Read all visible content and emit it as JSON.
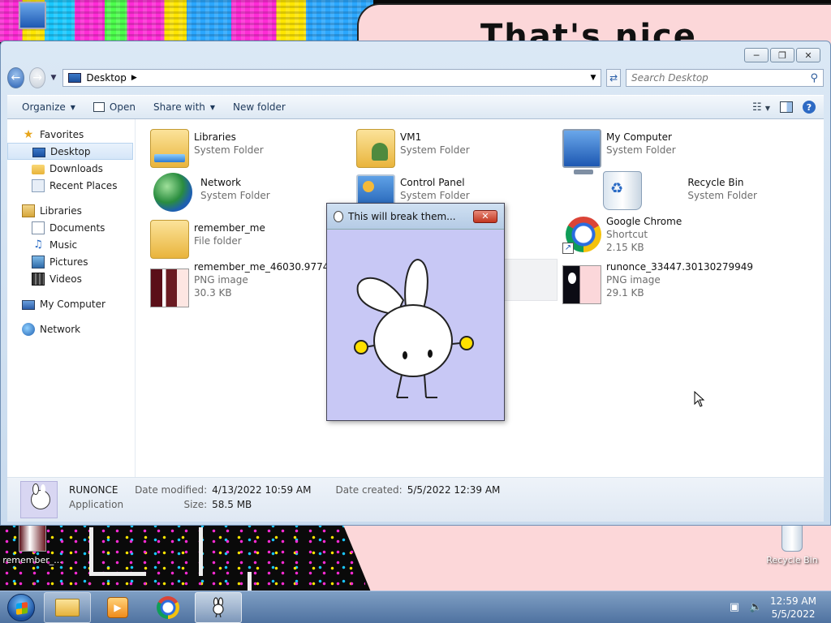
{
  "desktop": {
    "background_text": "That's nice",
    "icons": [
      {
        "label": ""
      },
      {
        "label": "remember_..."
      },
      {
        "label": "Recycle Bin"
      }
    ]
  },
  "explorer": {
    "address": {
      "location": "Desktop"
    },
    "search": {
      "placeholder": "Search Desktop"
    },
    "toolbar": {
      "organize": "Organize",
      "open": "Open",
      "share_with": "Share with",
      "new_folder": "New folder"
    },
    "nav_pane": {
      "favorites": "Favorites",
      "favorites_items": [
        "Desktop",
        "Downloads",
        "Recent Places"
      ],
      "libraries": "Libraries",
      "libraries_items": [
        "Documents",
        "Music",
        "Pictures",
        "Videos"
      ],
      "my_computer": "My Computer",
      "network": "Network"
    },
    "items": [
      {
        "name": "Libraries",
        "sub1": "System Folder",
        "sub2": ""
      },
      {
        "name": "VM1",
        "sub1": "System Folder",
        "sub2": ""
      },
      {
        "name": "My Computer",
        "sub1": "System Folder",
        "sub2": ""
      },
      {
        "name": "Network",
        "sub1": "System Folder",
        "sub2": ""
      },
      {
        "name": "Control Panel",
        "sub1": "System Folder",
        "sub2": ""
      },
      {
        "name": "Recycle Bin",
        "sub1": "System Folder",
        "sub2": ""
      },
      {
        "name": "remember_me",
        "sub1": "File folder",
        "sub2": ""
      },
      {
        "name": "Google Chrome",
        "sub1": "Shortcut",
        "sub2": "2.15 KB"
      },
      {
        "name": "remember_me_46030.97749985",
        "sub1": "PNG image",
        "sub2": "30.3 KB"
      },
      {
        "name": "runonce_33447.30130279949",
        "sub1": "PNG image",
        "sub2": "29.1 KB"
      }
    ],
    "details": {
      "name": "RUNONCE",
      "type": "Application",
      "date_modified_label": "Date modified:",
      "date_modified": "4/13/2022 10:59 AM",
      "date_created_label": "Date created:",
      "date_created": "5/5/2022 12:39 AM",
      "size_label": "Size:",
      "size": "58.5 MB"
    }
  },
  "popup": {
    "title": "This will break them...",
    "colors": {
      "background": "#c8c8f5",
      "hands": "#ffe000"
    }
  },
  "taskbar": {
    "time": "12:59 AM",
    "date": "5/5/2022"
  }
}
